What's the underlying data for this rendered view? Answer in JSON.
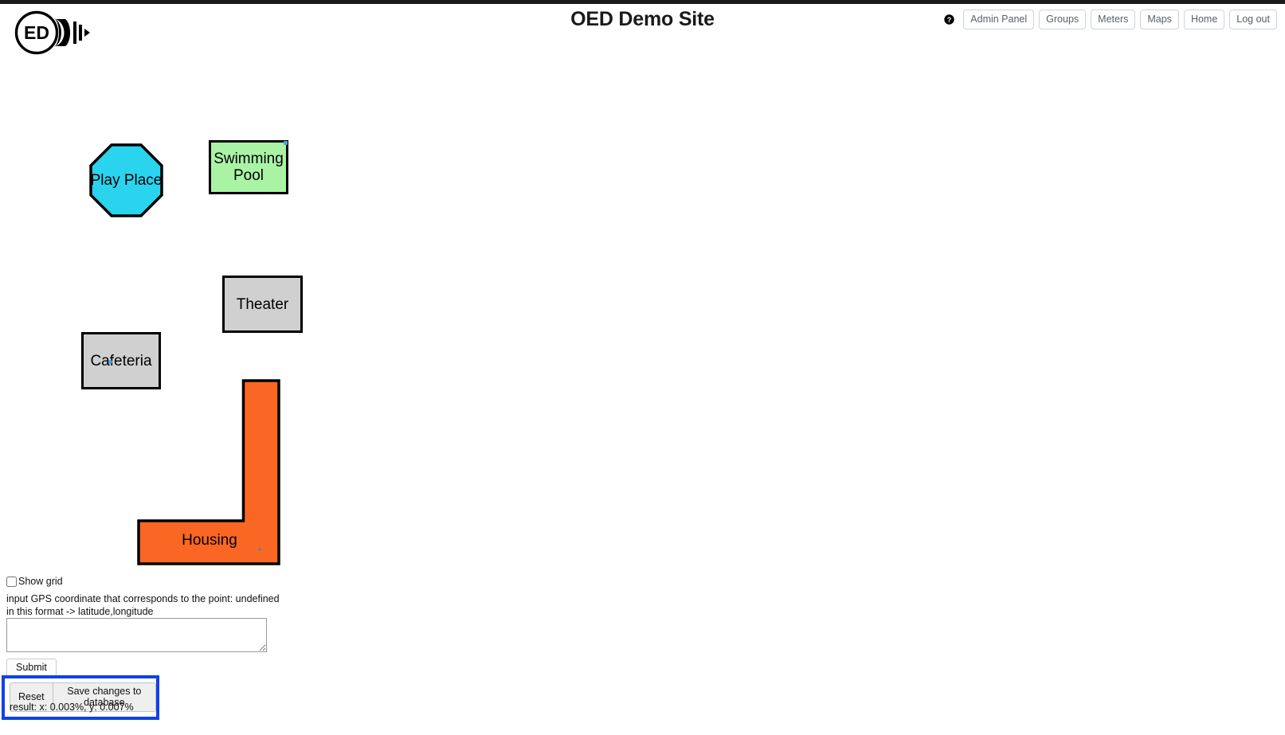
{
  "header": {
    "title": "OED Demo Site",
    "logo_alt": "OED lightbulb logo with ED letters",
    "help_icon": "help-circle-icon",
    "nav_items": [
      {
        "label": "Admin Panel"
      },
      {
        "label": "Groups"
      },
      {
        "label": "Meters"
      },
      {
        "label": "Maps"
      },
      {
        "label": "Home"
      },
      {
        "label": "Log out"
      }
    ]
  },
  "map": {
    "shapes": [
      {
        "id": "play-place",
        "label": "Play Place",
        "type": "octagon",
        "fill": "#2ad4ef",
        "stroke": "#000000"
      },
      {
        "id": "swimming-pool",
        "label": "Swimming Pool",
        "type": "rect",
        "fill": "#aaf3a5",
        "stroke": "#000000"
      },
      {
        "id": "theater",
        "label": "Theater",
        "type": "rect",
        "fill": "#d0d0d0",
        "stroke": "#000000"
      },
      {
        "id": "cafeteria",
        "label": "Cafeteria",
        "type": "rect",
        "fill": "#d0d0d0",
        "stroke": "#000000"
      },
      {
        "id": "housing",
        "label": "Housing",
        "type": "l-shape",
        "fill": "#fa6725",
        "stroke": "#000000"
      }
    ],
    "markers": [
      {
        "id": "swimming-pool-marker",
        "color": "#4ea3e0"
      },
      {
        "id": "cafeteria-marker",
        "color": "#4ea3e0"
      },
      {
        "id": "housing-marker",
        "color": "#7d7d7d"
      }
    ]
  },
  "controls": {
    "show_grid_label": "Show grid",
    "show_grid_checked": false,
    "hint_line1": "input GPS coordinate that corresponds to the point: undefined",
    "hint_line2": "in this format -> latitude,longitude",
    "gps_value": "",
    "gps_placeholder": "",
    "submit_label": "Submit",
    "reset_label": "Reset",
    "save_label": "Save changes to database",
    "result_text": "result: x: 0.003%, y: 0.007%",
    "highlight_color": "#1241e8"
  }
}
